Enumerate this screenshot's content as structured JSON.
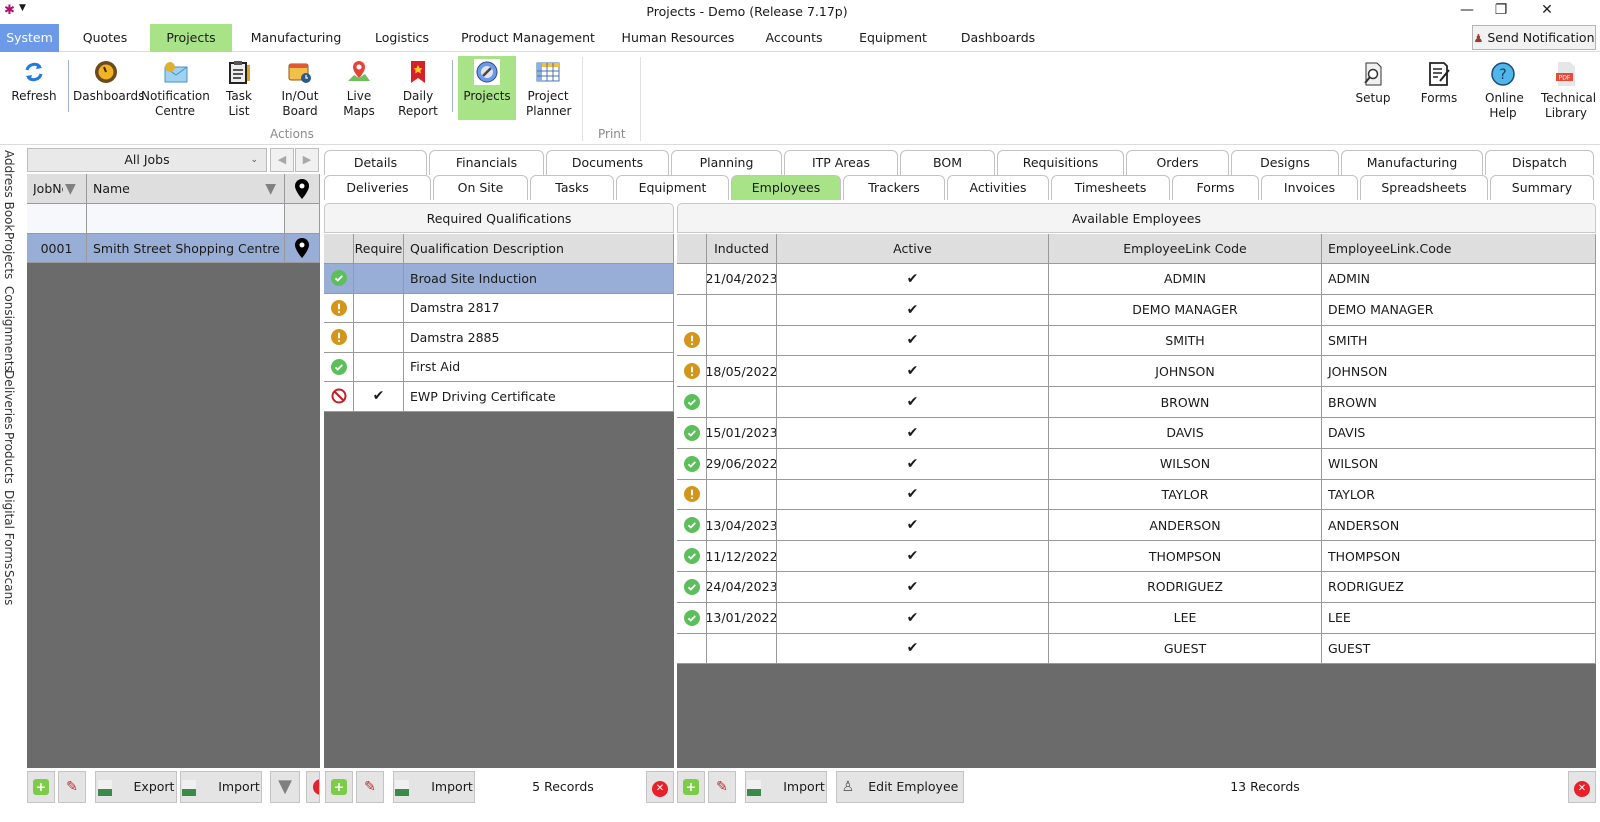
{
  "window": {
    "title": "Projects - Demo (Release 7.17p)",
    "controls": [
      "minimize",
      "restore",
      "close"
    ]
  },
  "menu": {
    "items": [
      {
        "label": "System",
        "state": "system"
      },
      {
        "label": "Quotes"
      },
      {
        "label": "Projects",
        "state": "active"
      },
      {
        "label": "Manufacturing"
      },
      {
        "label": "Logistics"
      },
      {
        "label": "Product Management"
      },
      {
        "label": "Human Resources"
      },
      {
        "label": "Accounts"
      },
      {
        "label": "Equipment"
      },
      {
        "label": "Dashboards"
      }
    ],
    "send_notification": "Send Notification"
  },
  "ribbon": {
    "buttons": [
      {
        "label": "Refresh",
        "icon": "refresh-icon"
      },
      {
        "label": "Dashboards",
        "icon": "dashboard-gauge-icon"
      },
      {
        "label": "Notification Centre",
        "icon": "envelope-icon"
      },
      {
        "label": "Task List",
        "icon": "clipboard-icon"
      },
      {
        "label": "In/Out Board",
        "icon": "calendar-clock-icon"
      },
      {
        "label": "Live Maps",
        "icon": "map-pin-icon"
      },
      {
        "label": "Daily Report",
        "icon": "bookmark-star-icon"
      },
      {
        "label": "Projects",
        "icon": "gear-wrench-icon",
        "active": true
      },
      {
        "label": "Project Planner",
        "icon": "spreadsheet-icon"
      }
    ],
    "group_actions": "Actions",
    "group_print": "Print",
    "right_buttons": [
      {
        "label": "Setup",
        "icon": "document-search-icon"
      },
      {
        "label": "Forms",
        "icon": "form-pen-icon"
      },
      {
        "label": "Online Help",
        "icon": "help-icon"
      },
      {
        "label": "Technical Library",
        "icon": "pdf-icon"
      }
    ]
  },
  "side_tabs": [
    "Address Book",
    "Projects",
    "Consignments",
    "Deliveries",
    "Products",
    "Digital Forms",
    "Scans"
  ],
  "jobs_panel": {
    "filter_combo": "All Jobs",
    "columns": [
      "JobNo",
      "Name"
    ],
    "rows": [
      {
        "job_no": "0001",
        "name": "Smith Street Shopping Centre",
        "selected": true
      }
    ],
    "toolbar": {
      "export": "Export",
      "import": "Import"
    }
  },
  "tabs": {
    "row1": [
      "Details",
      "Financials",
      "Documents",
      "Planning",
      "ITP Areas",
      "BOM",
      "Requisitions",
      "Orders",
      "Designs",
      "Manufacturing",
      "Dispatch"
    ],
    "row2": [
      "Deliveries",
      "On Site",
      "Tasks",
      "Equipment",
      "Employees",
      "Trackers",
      "Activities",
      "Timesheets",
      "Forms",
      "Invoices",
      "Spreadsheets",
      "Summary"
    ],
    "active": "Employees"
  },
  "qualifications": {
    "title": "Required Qualifications",
    "columns": [
      "",
      "Require",
      "Qualification Description"
    ],
    "rows": [
      {
        "status": "ok",
        "require": "",
        "description": "Broad Site Induction",
        "selected": true
      },
      {
        "status": "warn",
        "require": "",
        "description": "Damstra 2817"
      },
      {
        "status": "warn",
        "require": "",
        "description": "Damstra 2885"
      },
      {
        "status": "ok",
        "require": "",
        "description": "First Aid"
      },
      {
        "status": "blocked",
        "require": "✔",
        "description": "EWP Driving Certificate"
      }
    ],
    "toolbar": {
      "import": "Import"
    },
    "record_count": "5 Records"
  },
  "employees": {
    "title": "Available Employees",
    "columns": [
      "",
      "Inducted",
      "Active",
      "EmployeeLink Code",
      "EmployeeLink.Code"
    ],
    "rows": [
      {
        "status": "",
        "inducted": "21/04/2023",
        "active": "✔",
        "code": "ADMIN",
        "code2": "ADMIN"
      },
      {
        "status": "",
        "inducted": "",
        "active": "✔",
        "code": "DEMO MANAGER",
        "code2": "DEMO MANAGER"
      },
      {
        "status": "warn",
        "inducted": "",
        "active": "✔",
        "code": "SMITH",
        "code2": "SMITH"
      },
      {
        "status": "warn",
        "inducted": "18/05/2022",
        "active": "✔",
        "code": "JOHNSON",
        "code2": "JOHNSON"
      },
      {
        "status": "ok",
        "inducted": "",
        "active": "✔",
        "code": "BROWN",
        "code2": "BROWN"
      },
      {
        "status": "ok",
        "inducted": "15/01/2023",
        "active": "✔",
        "code": "DAVIS",
        "code2": "DAVIS"
      },
      {
        "status": "ok",
        "inducted": "29/06/2022",
        "active": "✔",
        "code": "WILSON",
        "code2": "WILSON"
      },
      {
        "status": "warn",
        "inducted": "",
        "active": "✔",
        "code": "TAYLOR",
        "code2": "TAYLOR"
      },
      {
        "status": "ok",
        "inducted": "13/04/2023",
        "active": "✔",
        "code": "ANDERSON",
        "code2": "ANDERSON"
      },
      {
        "status": "ok",
        "inducted": "11/12/2022",
        "active": "✔",
        "code": "THOMPSON",
        "code2": "THOMPSON"
      },
      {
        "status": "ok",
        "inducted": "24/04/2023",
        "active": "✔",
        "code": "RODRIGUEZ",
        "code2": "RODRIGUEZ"
      },
      {
        "status": "ok",
        "inducted": "13/01/2022",
        "active": "✔",
        "code": "LEE",
        "code2": "LEE"
      },
      {
        "status": "",
        "inducted": "",
        "active": "✔",
        "code": "GUEST",
        "code2": "GUEST"
      }
    ],
    "toolbar": {
      "import": "Import",
      "edit_employee": "Edit Employee"
    },
    "record_count": "13 Records"
  },
  "colors": {
    "accent_green": "#a9e387",
    "system_blue": "#6d9ae8",
    "selected_row": "#98aed6",
    "status_ok": "#5cbf5c",
    "status_warn": "#d4961a",
    "status_blocked": "#c0202a",
    "empty_area": "#6b6b6b"
  }
}
